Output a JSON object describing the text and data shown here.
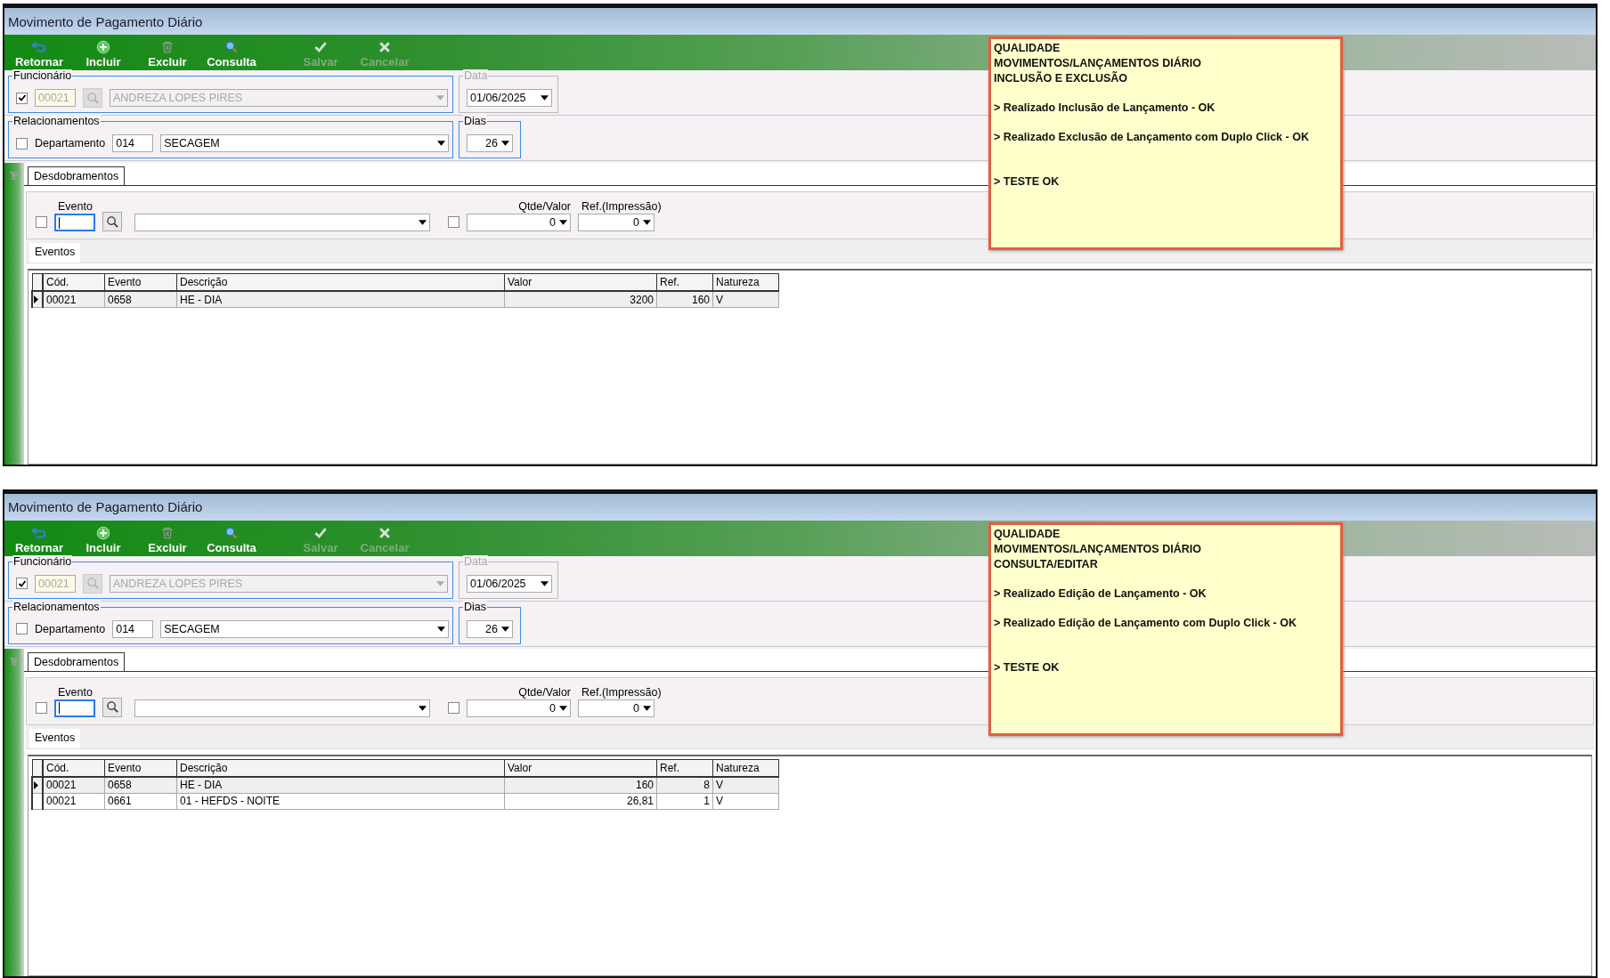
{
  "panels": [
    {
      "title": "Movimento de Pagamento Diário",
      "toolbar": [
        {
          "kind": "return",
          "label": "Retornar",
          "disabled": false
        },
        {
          "kind": "add",
          "label": "Incluir",
          "disabled": false
        },
        {
          "kind": "delete",
          "label": "Excluir",
          "disabled": false
        },
        {
          "kind": "search",
          "label": "Consulta",
          "disabled": false
        },
        {
          "kind": "save",
          "label": "Salvar",
          "disabled": true
        },
        {
          "kind": "cancel",
          "label": "Cancelar",
          "disabled": true
        }
      ],
      "funcionario": {
        "legend": "Funcionário",
        "checked": true,
        "code": "00021",
        "name": "ANDREZA LOPES PIRES",
        "disabled": true
      },
      "data": {
        "legend": "Data",
        "value": "01/06/2025",
        "disabled": true
      },
      "relacionamentos": {
        "legend": "Relacionamentos",
        "checked": false,
        "label": "Departamento",
        "code": "014",
        "name": "SECAGEM"
      },
      "dias": {
        "legend": "Dias",
        "value": "26"
      },
      "tabs": [
        {
          "label": "Desdobramentos",
          "selected": true
        }
      ],
      "evento": {
        "label": "Evento",
        "checked": false
      },
      "qtde_valor": {
        "label": "Qtde/Valor",
        "checked": false,
        "value": "0"
      },
      "ref_impressao": {
        "label": "Ref.(Impressão)",
        "value": "0"
      },
      "subtabs": [
        {
          "label": "Eventos",
          "selected": true
        }
      ],
      "grid": {
        "columns": [
          "Cód.",
          "Evento",
          "Descrição",
          "Valor",
          "Ref.",
          "Natureza"
        ],
        "rows": [
          {
            "selected": true,
            "cells": [
              "00021",
              "0658",
              "HE - DIA",
              "3200",
              "160",
              "V"
            ]
          }
        ]
      },
      "note": {
        "heading": [
          "QUALIDADE",
          "MOVIMENTOS/LANÇAMENTOS DIÁRIO",
          "INCLUSÃO E EXCLUSÃO"
        ],
        "checks": [
          "> Realizado Inclusão de Lançamento - OK",
          "> Realizado Exclusão de Lançamento com Duplo Click - OK"
        ],
        "result": "> TESTE OK"
      }
    },
    {
      "title": "Movimento de Pagamento Diário",
      "toolbar": [
        {
          "kind": "return",
          "label": "Retornar",
          "disabled": false
        },
        {
          "kind": "add",
          "label": "Incluir",
          "disabled": false
        },
        {
          "kind": "delete",
          "label": "Excluir",
          "disabled": false
        },
        {
          "kind": "search",
          "label": "Consulta",
          "disabled": false
        },
        {
          "kind": "save",
          "label": "Salvar",
          "disabled": true
        },
        {
          "kind": "cancel",
          "label": "Cancelar",
          "disabled": true
        }
      ],
      "funcionario": {
        "legend": "Funcionário",
        "checked": true,
        "code": "00021",
        "name": "ANDREZA LOPES PIRES",
        "disabled": true
      },
      "data": {
        "legend": "Data",
        "value": "01/06/2025",
        "disabled": true
      },
      "relacionamentos": {
        "legend": "Relacionamentos",
        "checked": false,
        "label": "Departamento",
        "code": "014",
        "name": "SECAGEM"
      },
      "dias": {
        "legend": "Dias",
        "value": "26"
      },
      "tabs": [
        {
          "label": "Desdobramentos",
          "selected": true
        }
      ],
      "evento": {
        "label": "Evento",
        "checked": false
      },
      "qtde_valor": {
        "label": "Qtde/Valor",
        "checked": false,
        "value": "0"
      },
      "ref_impressao": {
        "label": "Ref.(Impressão)",
        "value": "0"
      },
      "subtabs": [
        {
          "label": "Eventos",
          "selected": true
        }
      ],
      "grid": {
        "columns": [
          "Cód.",
          "Evento",
          "Descrição",
          "Valor",
          "Ref.",
          "Natureza"
        ],
        "rows": [
          {
            "selected": true,
            "cells": [
              "00021",
              "0658",
              "HE - DIA",
              "160",
              "8",
              "V"
            ]
          },
          {
            "selected": false,
            "cells": [
              "00021",
              "0661",
              "01 - HEFDS - NOITE",
              "26,81",
              "1",
              "V"
            ]
          }
        ]
      },
      "note": {
        "heading": [
          "QUALIDADE",
          "MOVIMENTOS/LANÇAMENTOS DIÁRIO",
          "CONSULTA/EDITAR"
        ],
        "checks": [
          "> Realizado Edição de Lançamento - OK",
          "> Realizado Edição de Lançamento com Duplo Click - OK"
        ],
        "result": "> TESTE OK"
      }
    }
  ]
}
